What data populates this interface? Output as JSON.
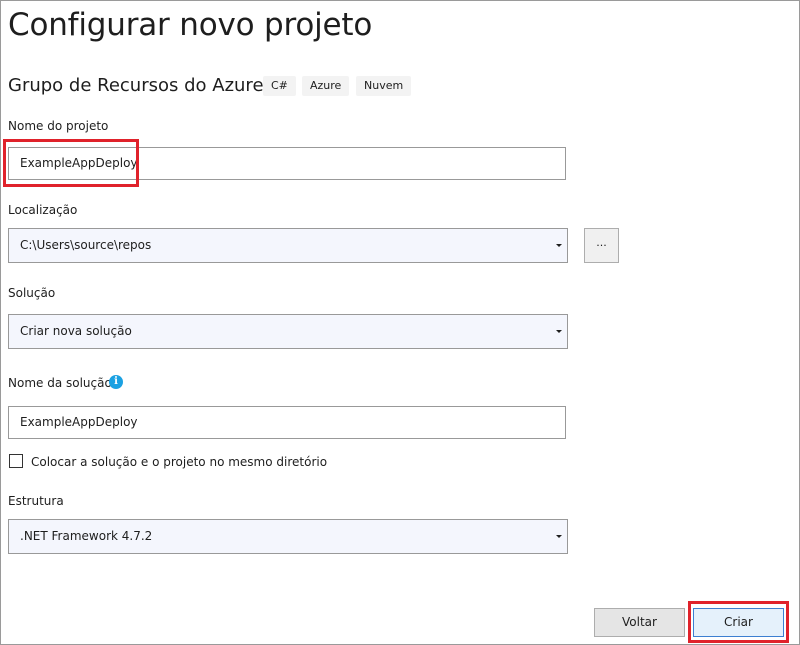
{
  "header": {
    "title": "Configurar novo projeto",
    "template_name": "Grupo de Recursos do Azure",
    "tags": [
      "C#",
      "Azure",
      "Nuvem"
    ]
  },
  "project_name": {
    "label": "Nome do projeto",
    "value": "ExampleAppDeploy"
  },
  "location": {
    "label": "Localização",
    "value": "C:\\Users\\source\\repos",
    "browse_label": "..."
  },
  "solution": {
    "label": "Solução",
    "value": "Criar nova solução"
  },
  "solution_name": {
    "label": "Nome da solução",
    "info_icon": "i",
    "value": "ExampleAppDeploy"
  },
  "same_directory": {
    "label": "Colocar a solução e o projeto no mesmo diretório",
    "checked": false
  },
  "framework": {
    "label": "Estrutura",
    "value": ".NET Framework 4.7.2"
  },
  "buttons": {
    "back_label": "Voltar",
    "create_label": "Criar"
  },
  "colors": {
    "highlight": "#e0222b",
    "info": "#1ba1e2",
    "primary_border": "#3c7fd1"
  }
}
